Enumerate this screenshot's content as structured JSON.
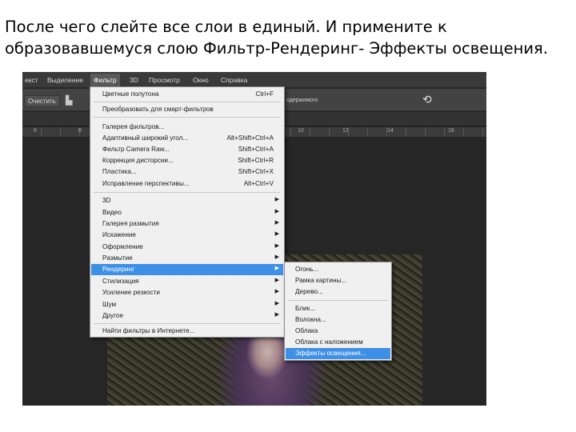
{
  "caption": "После чего слейте все слои в единый. И примените к образовавшемуся слою Фильтр-Рендеринг- Эффекты освещения.",
  "menubar": {
    "items": [
      "екст",
      "Выделение",
      "Фильтр",
      "3D",
      "Просмотр",
      "Окно",
      "Справка"
    ],
    "active": "Фильтр"
  },
  "options_bar": {
    "clear_label": "Очистить",
    "truncated_text": "одержимого"
  },
  "ruler": {
    "labels": [
      "6",
      "8",
      "10",
      "12",
      "14",
      "16"
    ]
  },
  "filter_menu": {
    "items": [
      {
        "label": "Цветные полутона",
        "shortcut": "Ctrl+F"
      },
      {
        "label": "Преобразовать для смарт-фильтров",
        "shortcut": ""
      },
      {
        "label": "Галерея фильтров...",
        "shortcut": ""
      },
      {
        "label": "Адаптивный широкий угол...",
        "shortcut": "Alt+Shift+Ctrl+A"
      },
      {
        "label": "Фильтр Camera Raw...",
        "shortcut": "Shift+Ctrl+A"
      },
      {
        "label": "Коррекция дисторсии...",
        "shortcut": "Shift+Ctrl+R"
      },
      {
        "label": "Пластика...",
        "shortcut": "Shift+Ctrl+X"
      },
      {
        "label": "Исправление перспективы...",
        "shortcut": "Alt+Ctrl+V"
      },
      {
        "label": "3D"
      },
      {
        "label": "Видео"
      },
      {
        "label": "Галерея размытия"
      },
      {
        "label": "Искажение"
      },
      {
        "label": "Оформление"
      },
      {
        "label": "Размытие"
      },
      {
        "label": "Рендеринг"
      },
      {
        "label": "Стилизация"
      },
      {
        "label": "Усиление резкости"
      },
      {
        "label": "Шум"
      },
      {
        "label": "Другое"
      },
      {
        "label": "Найти фильтры в Интернете..."
      }
    ],
    "highlighted": "Рендеринг"
  },
  "render_submenu": {
    "items": [
      "Огонь...",
      "Рамка картины...",
      "Дерево...",
      "Блик...",
      "Волокна...",
      "Облака",
      "Облака с наложением",
      "Эффекты освещения..."
    ],
    "highlighted": "Эффекты освещения..."
  },
  "colors": {
    "highlight": "#3e90e6",
    "menu_bg": "#f0f0f0",
    "workspace": "#262626"
  },
  "icons": [
    "brush-icon",
    "undo-icon",
    "submenu-arrow-icon"
  ]
}
